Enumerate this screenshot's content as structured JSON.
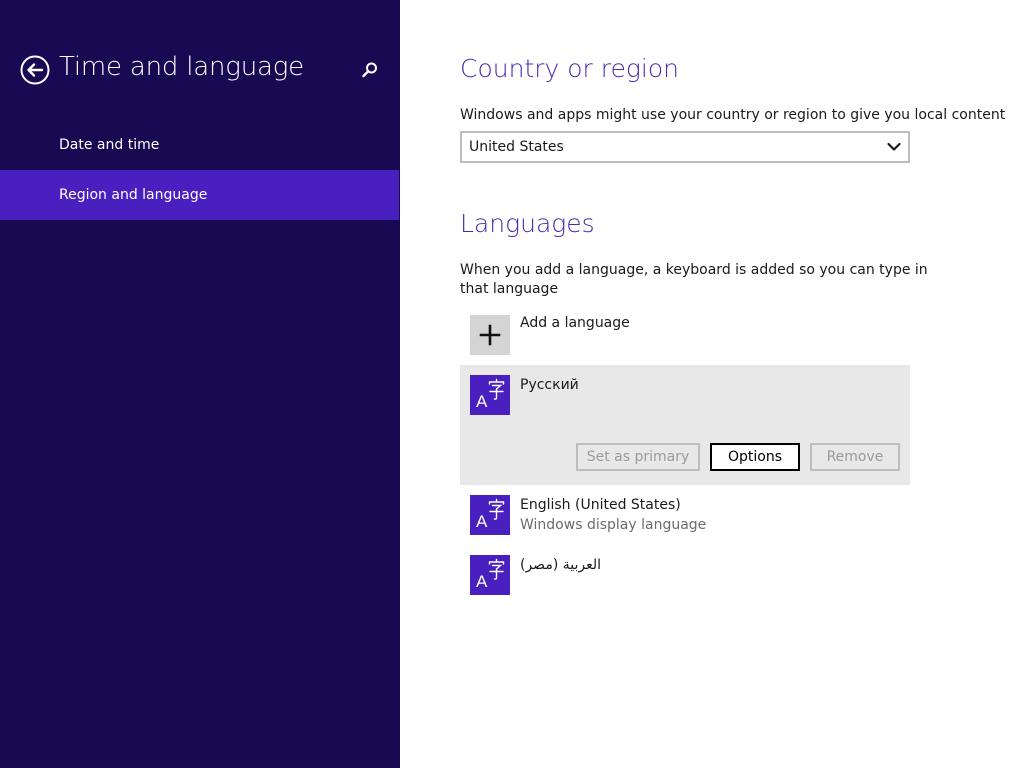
{
  "nav": {
    "title": "Time and language",
    "items": [
      {
        "label": "Date and time",
        "selected": false
      },
      {
        "label": "Region and language",
        "selected": true
      }
    ],
    "icons": {
      "back": "back-arrow-icon",
      "search": "search-icon"
    }
  },
  "country": {
    "heading": "Country or region",
    "description": "Windows and apps might use your country or region to give you local content",
    "selected_value": "United States"
  },
  "languages": {
    "heading": "Languages",
    "description": "When you add a language, a keyboard is added so you can type in that language",
    "add_label": "Add a language",
    "items": [
      {
        "name": "Русский",
        "subtitle": "",
        "selected": true,
        "actions": {
          "set_primary": "Set as primary",
          "options": "Options",
          "remove": "Remove"
        }
      },
      {
        "name": "English (United States)",
        "subtitle": "Windows display language",
        "selected": false
      },
      {
        "name": "العربية (مصر)",
        "subtitle": "",
        "selected": false
      }
    ]
  },
  "colors": {
    "nav_background": "#180a52",
    "accent": "#4a1fc0",
    "heading": "#4a2bb0",
    "selected_row": "#e8e8e8"
  }
}
